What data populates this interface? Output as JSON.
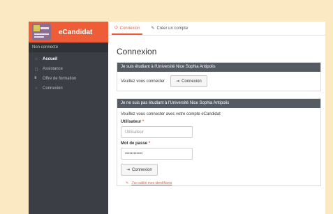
{
  "app": {
    "name": "eCandidat",
    "status": "Non connecté"
  },
  "sidebar": {
    "items": [
      {
        "label": "Accueil",
        "icon": "home-icon",
        "glyph": "⌂",
        "active": true
      },
      {
        "label": "Assistance",
        "icon": "help-icon",
        "glyph": "◻",
        "active": false
      },
      {
        "label": "Offre de formation",
        "icon": "bookmark-icon",
        "glyph": "▘",
        "active": false
      },
      {
        "label": "Connexion",
        "icon": "power-icon",
        "glyph": "○",
        "active": false
      }
    ]
  },
  "tabs": [
    {
      "label": "Connexion",
      "icon": "power-icon",
      "glyph": "⏻",
      "active": true
    },
    {
      "label": "Créer un compte",
      "icon": "pencil-icon",
      "glyph": "✎",
      "active": false
    }
  ],
  "main": {
    "title": "Connexion",
    "student_panel": {
      "heading": "Je suis étudiant à l'Université Nice Sophia Antipolis",
      "text": "Veuillez vous connecter",
      "button": "Connexion",
      "button_glyph": "⇥"
    },
    "external_panel": {
      "heading": "Je ne suis pas étudiant à l'Université Nice Sophia Antipolis",
      "text": "Veuillez vous connecter avec votre compte eCandidat",
      "user_label": "Utilisateur",
      "user_placeholder": "Utilisateur",
      "password_label": "Mot de passe",
      "password_value": "••••••••••••",
      "required_mark": "*",
      "button": "Connexion",
      "button_glyph": "⇥",
      "forgot_glyph": "✎",
      "forgot_link": "J'ai oublié mes identifiants"
    }
  },
  "colors": {
    "accent": "#ef5d38",
    "sidebar": "#3b3f45",
    "panel_header": "#545b63",
    "background": "#fbe9c4"
  }
}
